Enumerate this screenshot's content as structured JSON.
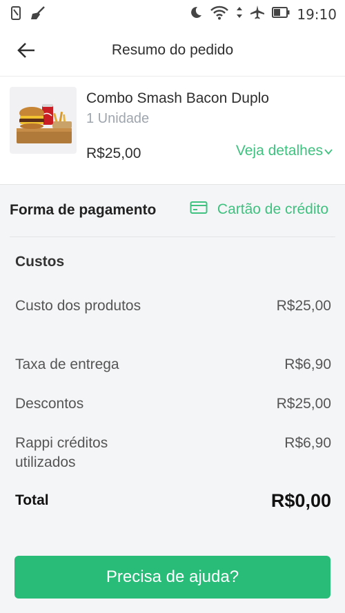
{
  "status_bar": {
    "time": "19:10",
    "icons": [
      "phone-icon",
      "broom-icon",
      "moon-icon",
      "wifi-icon",
      "airplane-icon",
      "battery-icon"
    ]
  },
  "header": {
    "title": "Resumo do pedido",
    "back_icon": "arrow-left-icon"
  },
  "product": {
    "name": "Combo Smash Bacon Duplo",
    "units": "1 Unidade",
    "price": "R$25,00",
    "details_link": "Veja detalhes",
    "details_icon": "chevron-down-icon"
  },
  "payment": {
    "label": "Forma de pagamento",
    "method": "Cartão de crédito",
    "method_icon": "credit-card-icon"
  },
  "costs": {
    "title": "Custos",
    "rows": [
      {
        "label": "Custo dos produtos",
        "value": "R$25,00"
      },
      {
        "label": "Taxa de entrega",
        "value": "R$6,90"
      },
      {
        "label": "Descontos",
        "value": "R$25,00"
      },
      {
        "label": "Rappi créditos utilizados",
        "value": "R$6,90"
      }
    ],
    "total_label": "Total",
    "total_value": "R$0,00"
  },
  "help_button": {
    "label": "Precisa de ajuda?"
  },
  "colors": {
    "accent": "#3fc17f",
    "button": "#29bb78",
    "background": "#f4f5f7"
  }
}
